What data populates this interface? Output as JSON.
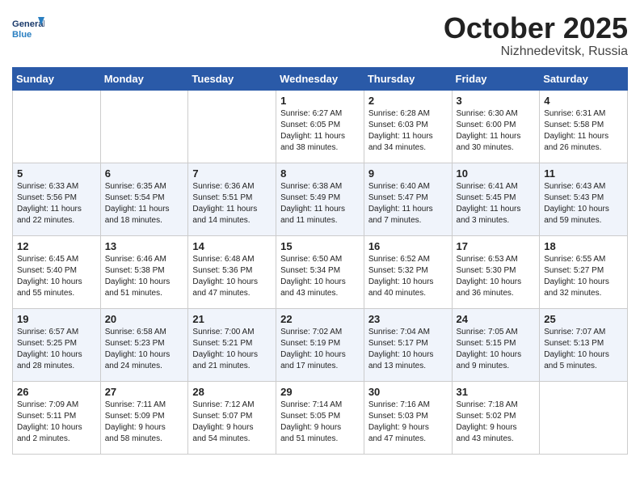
{
  "header": {
    "logo_text_general": "General",
    "logo_text_blue": "Blue",
    "month": "October 2025",
    "location": "Nizhnedevitsk, Russia"
  },
  "days_of_week": [
    "Sunday",
    "Monday",
    "Tuesday",
    "Wednesday",
    "Thursday",
    "Friday",
    "Saturday"
  ],
  "weeks": [
    [
      {
        "num": "",
        "info": ""
      },
      {
        "num": "",
        "info": ""
      },
      {
        "num": "",
        "info": ""
      },
      {
        "num": "1",
        "info": "Sunrise: 6:27 AM\nSunset: 6:05 PM\nDaylight: 11 hours\nand 38 minutes."
      },
      {
        "num": "2",
        "info": "Sunrise: 6:28 AM\nSunset: 6:03 PM\nDaylight: 11 hours\nand 34 minutes."
      },
      {
        "num": "3",
        "info": "Sunrise: 6:30 AM\nSunset: 6:00 PM\nDaylight: 11 hours\nand 30 minutes."
      },
      {
        "num": "4",
        "info": "Sunrise: 6:31 AM\nSunset: 5:58 PM\nDaylight: 11 hours\nand 26 minutes."
      }
    ],
    [
      {
        "num": "5",
        "info": "Sunrise: 6:33 AM\nSunset: 5:56 PM\nDaylight: 11 hours\nand 22 minutes."
      },
      {
        "num": "6",
        "info": "Sunrise: 6:35 AM\nSunset: 5:54 PM\nDaylight: 11 hours\nand 18 minutes."
      },
      {
        "num": "7",
        "info": "Sunrise: 6:36 AM\nSunset: 5:51 PM\nDaylight: 11 hours\nand 14 minutes."
      },
      {
        "num": "8",
        "info": "Sunrise: 6:38 AM\nSunset: 5:49 PM\nDaylight: 11 hours\nand 11 minutes."
      },
      {
        "num": "9",
        "info": "Sunrise: 6:40 AM\nSunset: 5:47 PM\nDaylight: 11 hours\nand 7 minutes."
      },
      {
        "num": "10",
        "info": "Sunrise: 6:41 AM\nSunset: 5:45 PM\nDaylight: 11 hours\nand 3 minutes."
      },
      {
        "num": "11",
        "info": "Sunrise: 6:43 AM\nSunset: 5:43 PM\nDaylight: 10 hours\nand 59 minutes."
      }
    ],
    [
      {
        "num": "12",
        "info": "Sunrise: 6:45 AM\nSunset: 5:40 PM\nDaylight: 10 hours\nand 55 minutes."
      },
      {
        "num": "13",
        "info": "Sunrise: 6:46 AM\nSunset: 5:38 PM\nDaylight: 10 hours\nand 51 minutes."
      },
      {
        "num": "14",
        "info": "Sunrise: 6:48 AM\nSunset: 5:36 PM\nDaylight: 10 hours\nand 47 minutes."
      },
      {
        "num": "15",
        "info": "Sunrise: 6:50 AM\nSunset: 5:34 PM\nDaylight: 10 hours\nand 43 minutes."
      },
      {
        "num": "16",
        "info": "Sunrise: 6:52 AM\nSunset: 5:32 PM\nDaylight: 10 hours\nand 40 minutes."
      },
      {
        "num": "17",
        "info": "Sunrise: 6:53 AM\nSunset: 5:30 PM\nDaylight: 10 hours\nand 36 minutes."
      },
      {
        "num": "18",
        "info": "Sunrise: 6:55 AM\nSunset: 5:27 PM\nDaylight: 10 hours\nand 32 minutes."
      }
    ],
    [
      {
        "num": "19",
        "info": "Sunrise: 6:57 AM\nSunset: 5:25 PM\nDaylight: 10 hours\nand 28 minutes."
      },
      {
        "num": "20",
        "info": "Sunrise: 6:58 AM\nSunset: 5:23 PM\nDaylight: 10 hours\nand 24 minutes."
      },
      {
        "num": "21",
        "info": "Sunrise: 7:00 AM\nSunset: 5:21 PM\nDaylight: 10 hours\nand 21 minutes."
      },
      {
        "num": "22",
        "info": "Sunrise: 7:02 AM\nSunset: 5:19 PM\nDaylight: 10 hours\nand 17 minutes."
      },
      {
        "num": "23",
        "info": "Sunrise: 7:04 AM\nSunset: 5:17 PM\nDaylight: 10 hours\nand 13 minutes."
      },
      {
        "num": "24",
        "info": "Sunrise: 7:05 AM\nSunset: 5:15 PM\nDaylight: 10 hours\nand 9 minutes."
      },
      {
        "num": "25",
        "info": "Sunrise: 7:07 AM\nSunset: 5:13 PM\nDaylight: 10 hours\nand 5 minutes."
      }
    ],
    [
      {
        "num": "26",
        "info": "Sunrise: 7:09 AM\nSunset: 5:11 PM\nDaylight: 10 hours\nand 2 minutes."
      },
      {
        "num": "27",
        "info": "Sunrise: 7:11 AM\nSunset: 5:09 PM\nDaylight: 9 hours\nand 58 minutes."
      },
      {
        "num": "28",
        "info": "Sunrise: 7:12 AM\nSunset: 5:07 PM\nDaylight: 9 hours\nand 54 minutes."
      },
      {
        "num": "29",
        "info": "Sunrise: 7:14 AM\nSunset: 5:05 PM\nDaylight: 9 hours\nand 51 minutes."
      },
      {
        "num": "30",
        "info": "Sunrise: 7:16 AM\nSunset: 5:03 PM\nDaylight: 9 hours\nand 47 minutes."
      },
      {
        "num": "31",
        "info": "Sunrise: 7:18 AM\nSunset: 5:02 PM\nDaylight: 9 hours\nand 43 minutes."
      },
      {
        "num": "",
        "info": ""
      }
    ]
  ]
}
